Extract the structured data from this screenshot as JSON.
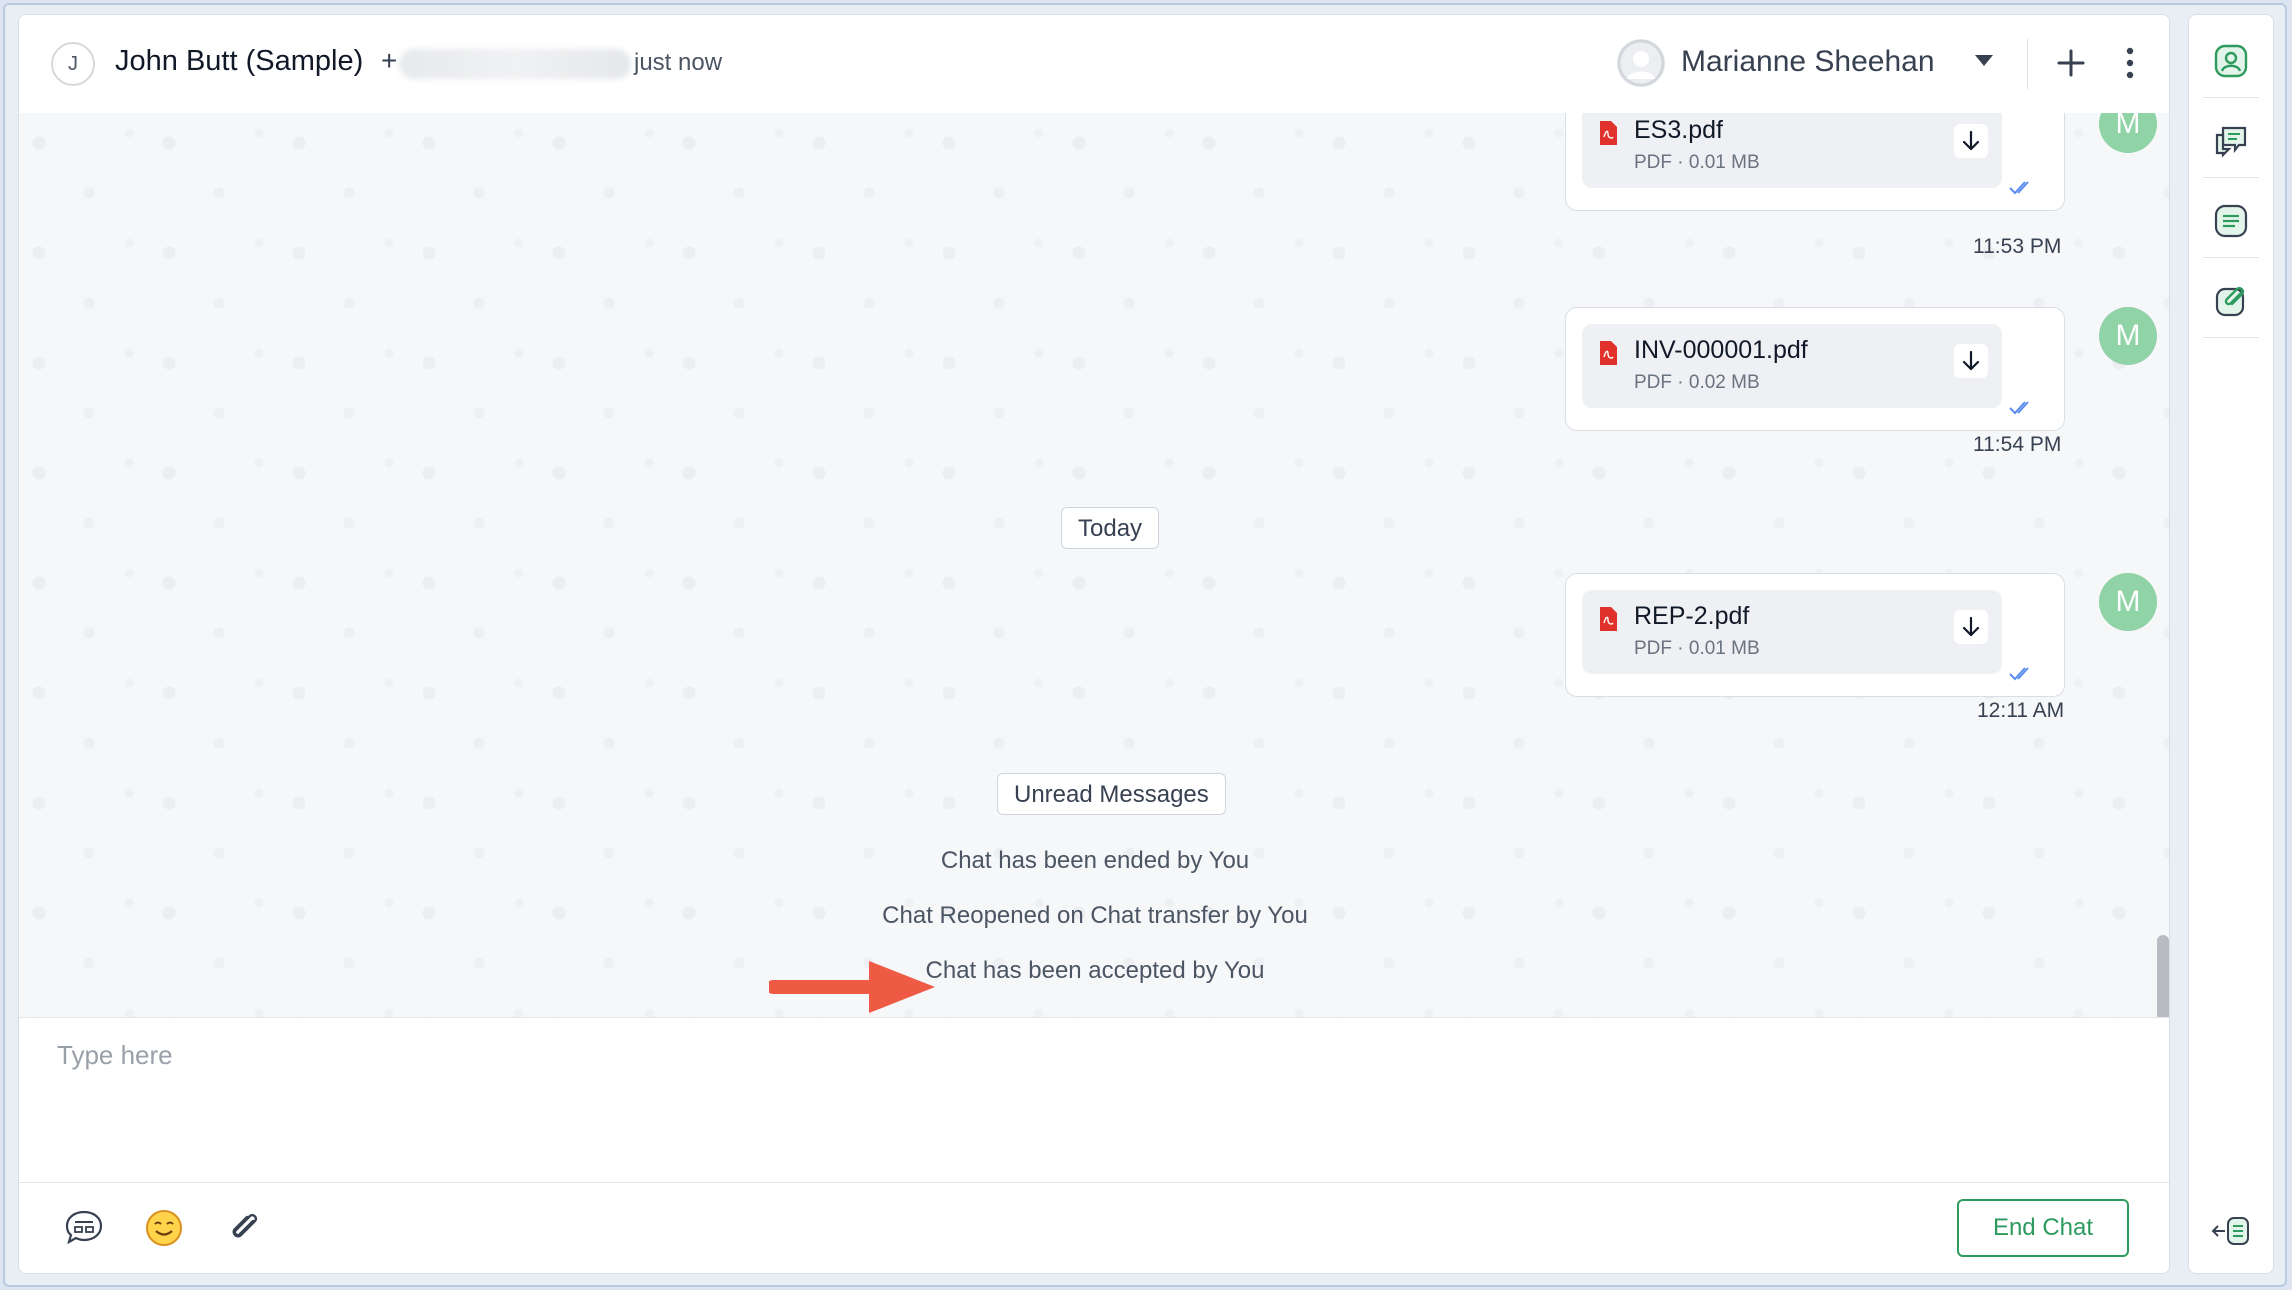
{
  "header": {
    "contact_initial": "J",
    "contact_name": "John Butt (Sample)",
    "contact_plus": "+",
    "last_seen": "just now",
    "agent_name": "Marianne Sheehan"
  },
  "messages": [
    {
      "file_name": "ES3.pdf",
      "file_type": "PDF",
      "file_size": "0.01 MB",
      "time": "11:53 PM",
      "sender_initial": "M"
    },
    {
      "file_name": "INV-000001.pdf",
      "file_type": "PDF",
      "file_size": "0.02 MB",
      "time": "11:54 PM",
      "sender_initial": "M"
    },
    {
      "file_name": "REP-2.pdf",
      "file_type": "PDF",
      "file_size": "0.01 MB",
      "time": "12:11 AM",
      "sender_initial": "M"
    }
  ],
  "separators": {
    "today": "Today",
    "unread": "Unread Messages"
  },
  "system_messages": [
    "Chat has been ended by You",
    "Chat Reopened on Chat transfer by You",
    "Chat has been accepted by You"
  ],
  "composer": {
    "placeholder": "Type here"
  },
  "footer": {
    "end_chat_label": "End Chat"
  },
  "colors": {
    "accent_green": "#2e9b5e",
    "avatar_green": "#8fd3a7",
    "pdf_red": "#e0312b",
    "tick_blue": "#5b8def"
  }
}
